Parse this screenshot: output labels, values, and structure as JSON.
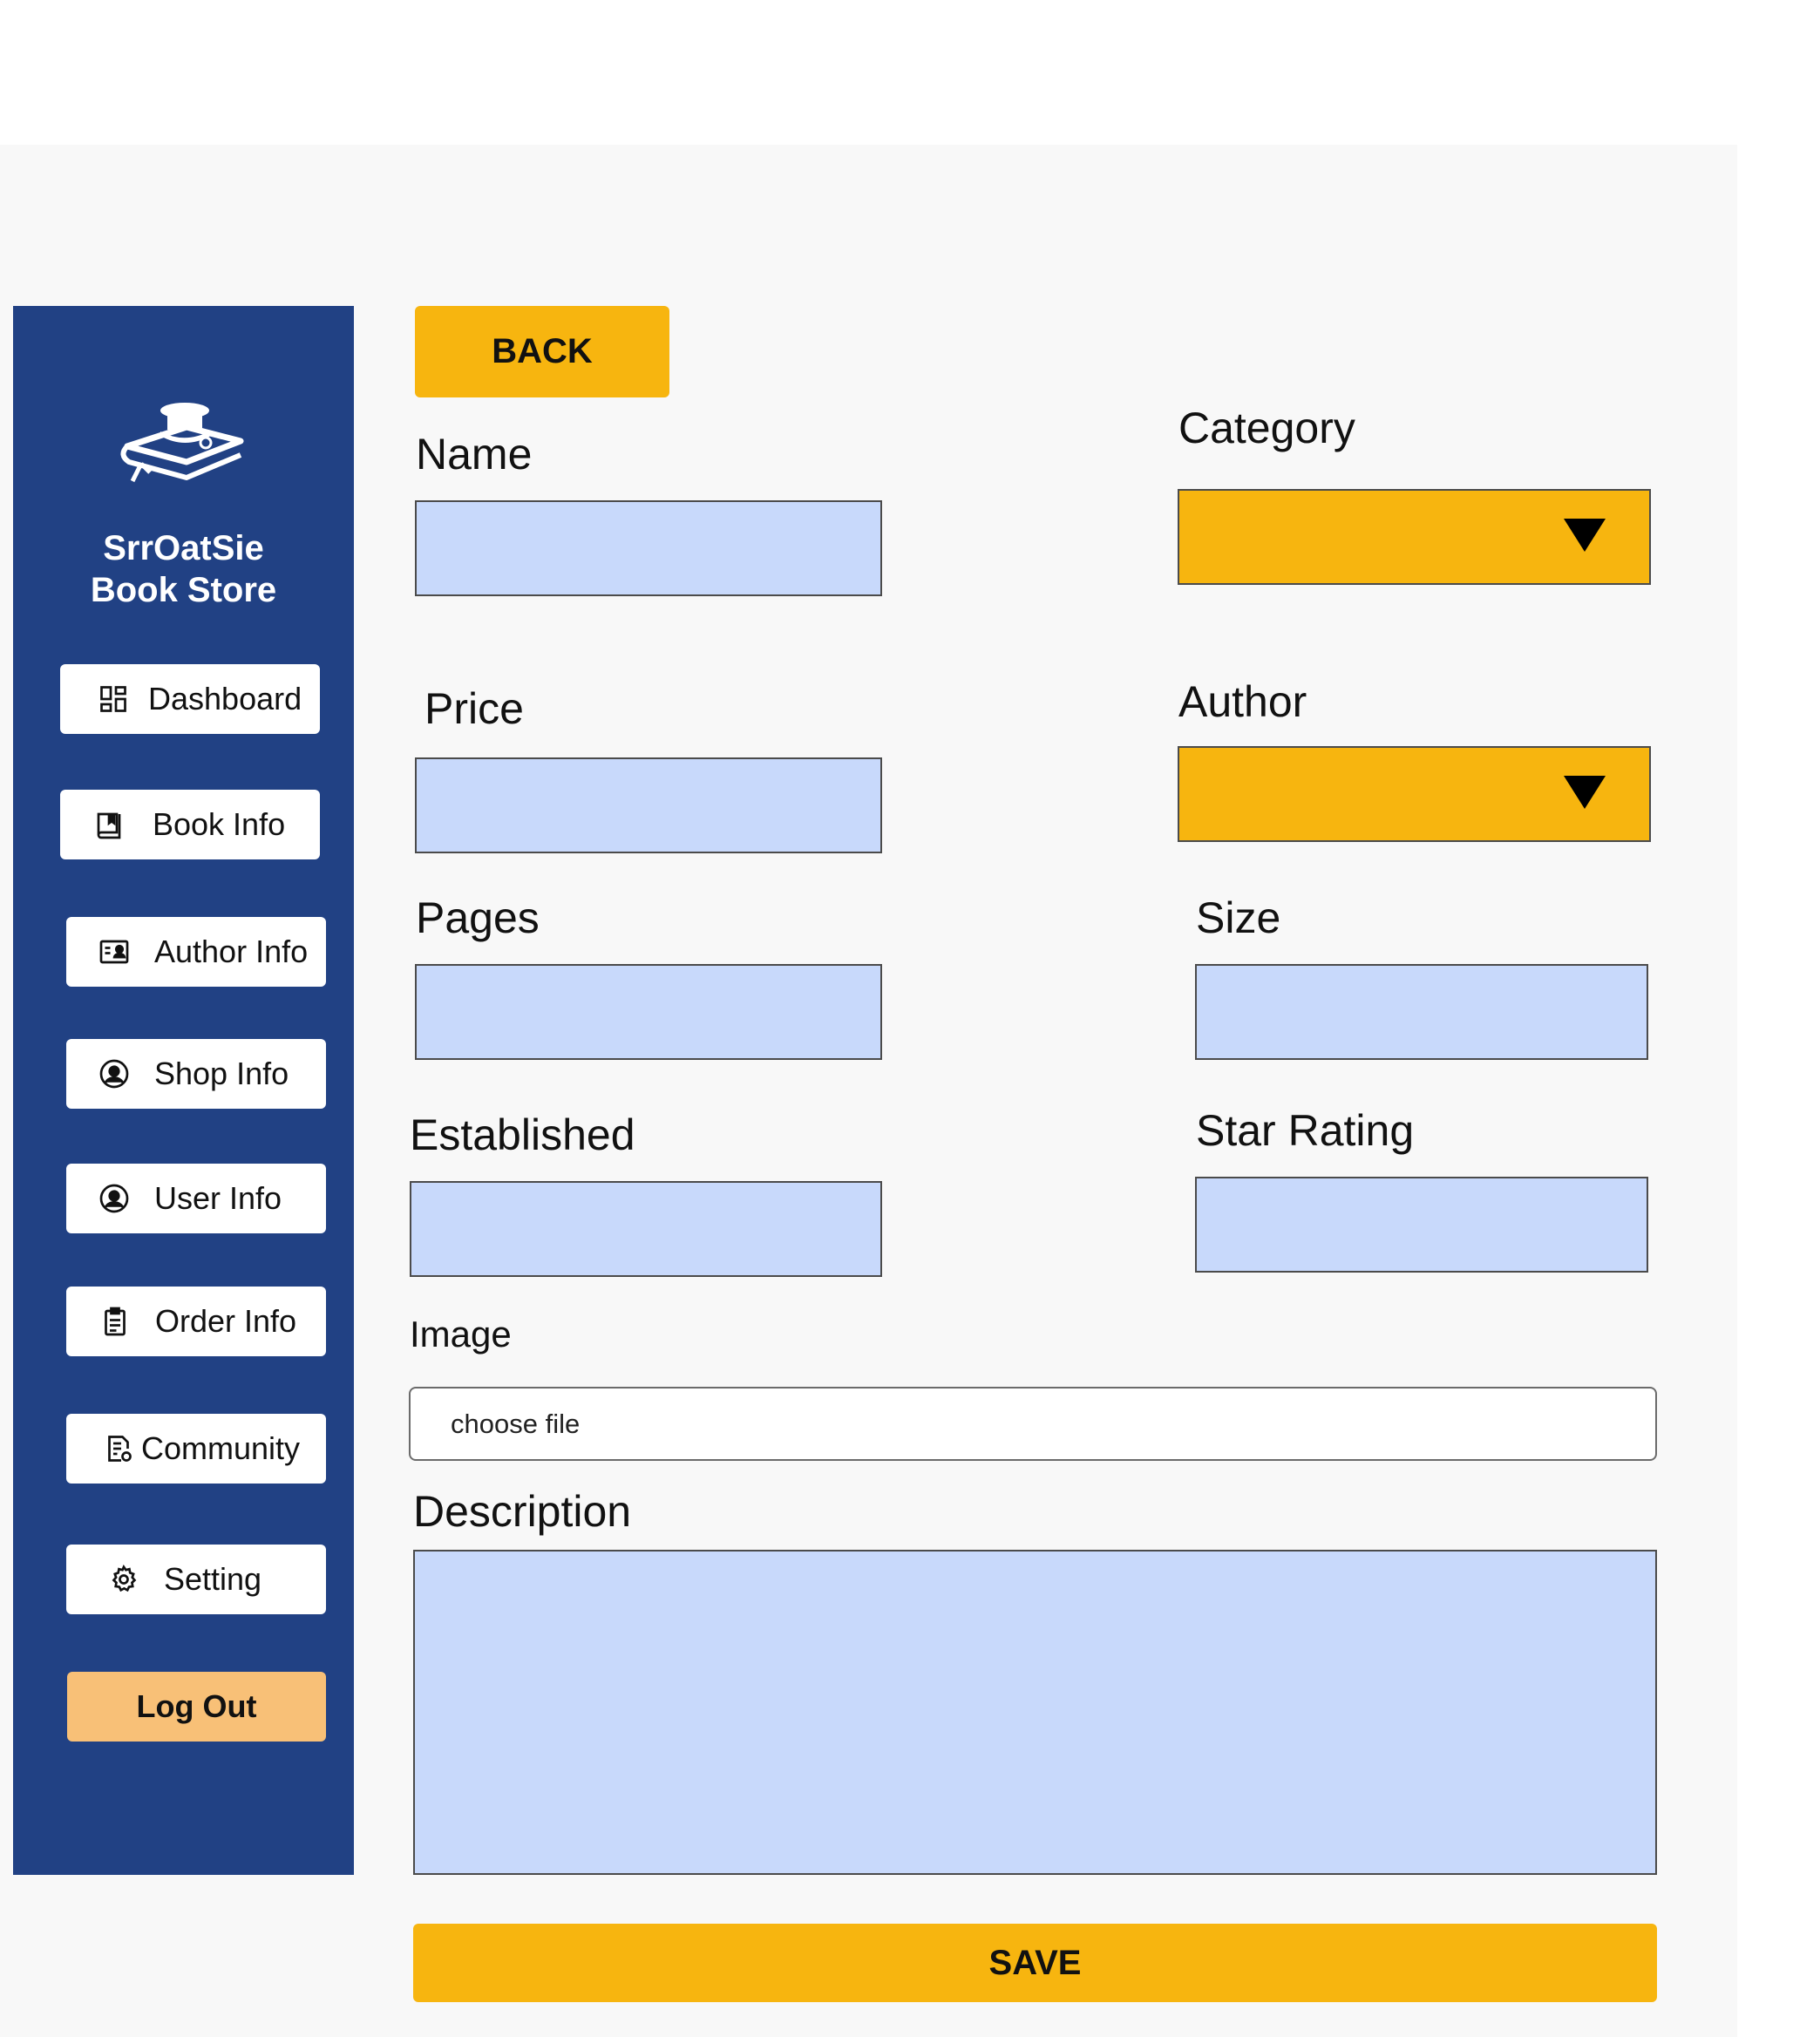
{
  "sidebar": {
    "brand_line1": "SrrOatSie",
    "brand_line2": "Book Store",
    "logo_icon": "book-hat-icon",
    "items": [
      {
        "label": "Dashboard",
        "icon": "dashboard-icon"
      },
      {
        "label": "Book Info",
        "icon": "book-icon"
      },
      {
        "label": "Author Info",
        "icon": "id-card-icon"
      },
      {
        "label": "Shop Info",
        "icon": "user-circle-icon"
      },
      {
        "label": "User Info",
        "icon": "user-circle-icon"
      },
      {
        "label": "Order Info",
        "icon": "clipboard-icon"
      },
      {
        "label": "Community",
        "icon": "document-settings-icon"
      },
      {
        "label": "Setting",
        "icon": "gear-icon"
      }
    ],
    "logout_label": "Log Out"
  },
  "form": {
    "back_label": "BACK",
    "name_label": "Name",
    "category_label": "Category",
    "price_label": "Price",
    "author_label": "Author",
    "pages_label": "Pages",
    "size_label": "Size",
    "established_label": "Established",
    "star_rating_label": "Star Rating",
    "image_label": "Image",
    "file_placeholder": "choose file",
    "description_label": "Description",
    "save_label": "SAVE"
  },
  "colors": {
    "sidebar_bg": "#214184",
    "accent_yellow": "#f7b50f",
    "input_blue": "#c8d9fb",
    "logout_orange": "#f8c077"
  }
}
